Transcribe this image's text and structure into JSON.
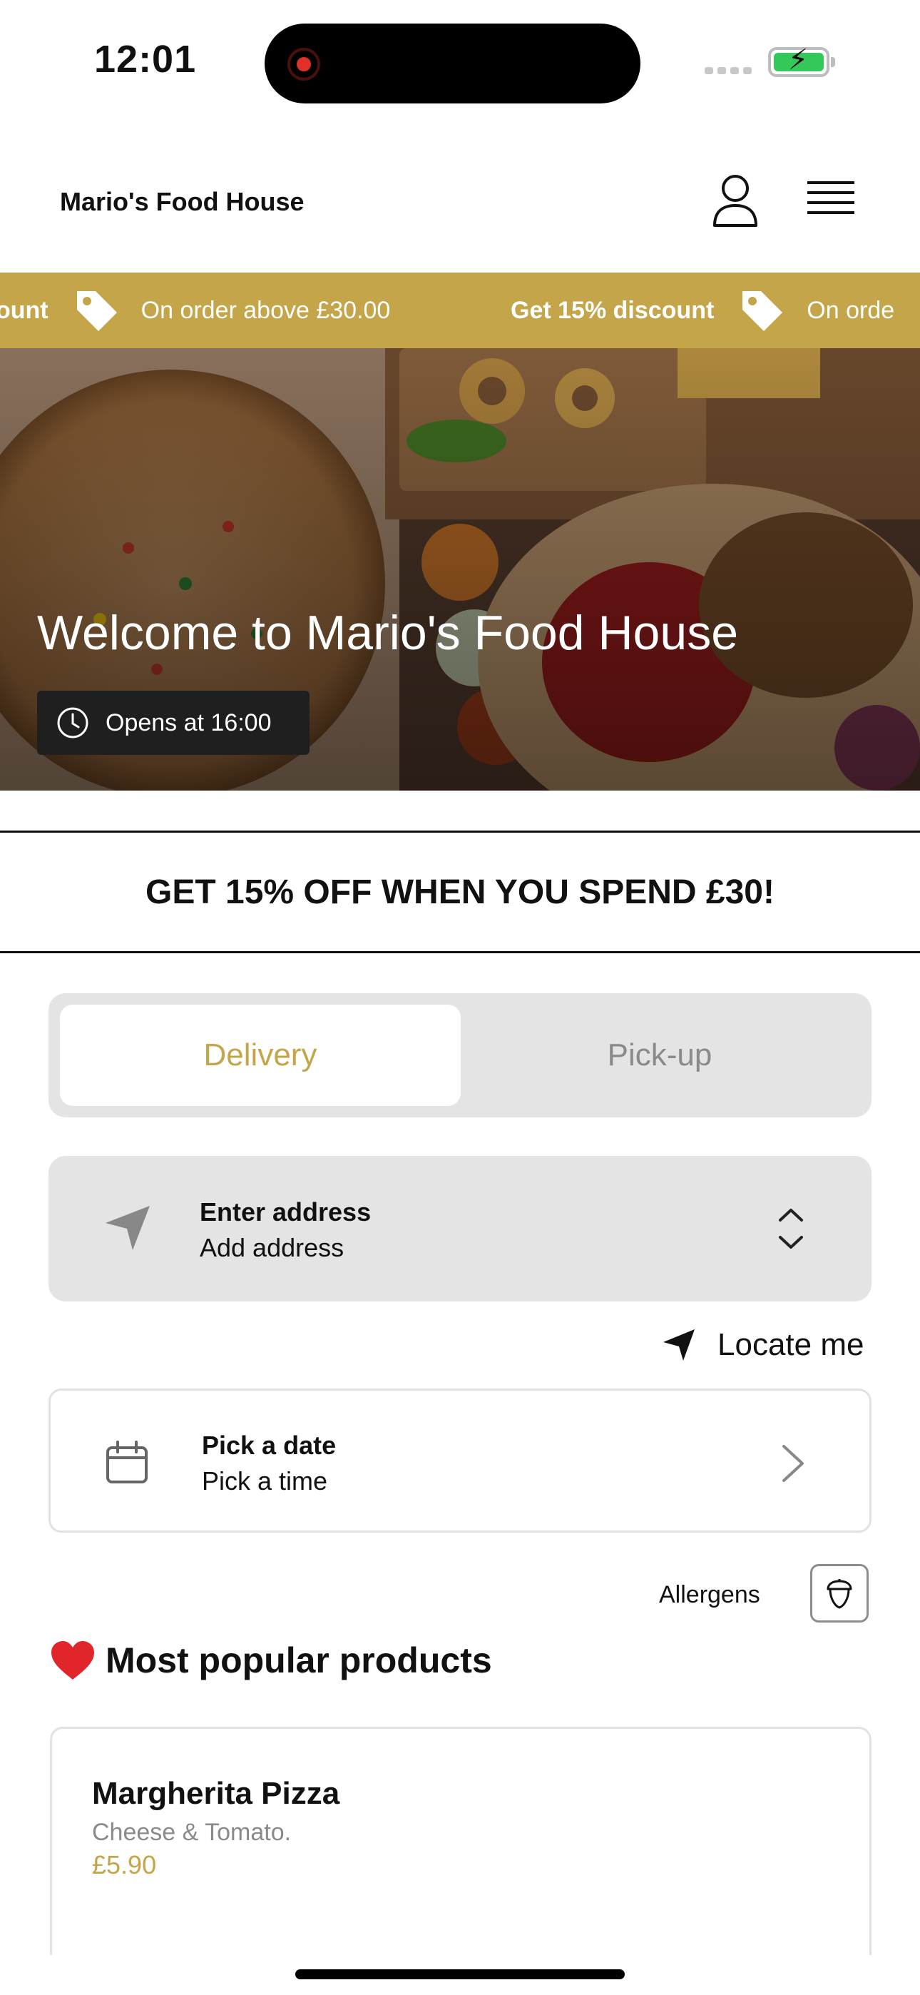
{
  "status_bar": {
    "time": "12:01"
  },
  "header": {
    "brand": "Mario's Food House"
  },
  "ticker": {
    "items": [
      {
        "bold": "ount",
        "text": "On order above £30.00"
      },
      {
        "bold": "Get 15% discount",
        "text": "On orde"
      }
    ]
  },
  "hero": {
    "title": "Welcome to Mario's Food House",
    "opens": "Opens at 16:00"
  },
  "promo": {
    "text": "GET 15% OFF WHEN YOU SPEND £30!"
  },
  "order_mode": {
    "delivery": "Delivery",
    "pickup": "Pick-up",
    "selected": "Delivery"
  },
  "address": {
    "title": "Enter address",
    "subtitle": "Add address"
  },
  "locate": {
    "label": "Locate me"
  },
  "schedule": {
    "title": "Pick a date",
    "subtitle": "Pick a time"
  },
  "allergens": {
    "label": "Allergens"
  },
  "popular": {
    "heading": "Most popular products",
    "products": [
      {
        "name": "Margherita Pizza",
        "description": "Cheese & Tomato.",
        "price": "£5.90"
      }
    ]
  },
  "colors": {
    "accent": "#c4a54a",
    "toggle_bg": "#e4e4e4",
    "heart": "#e0262b"
  }
}
